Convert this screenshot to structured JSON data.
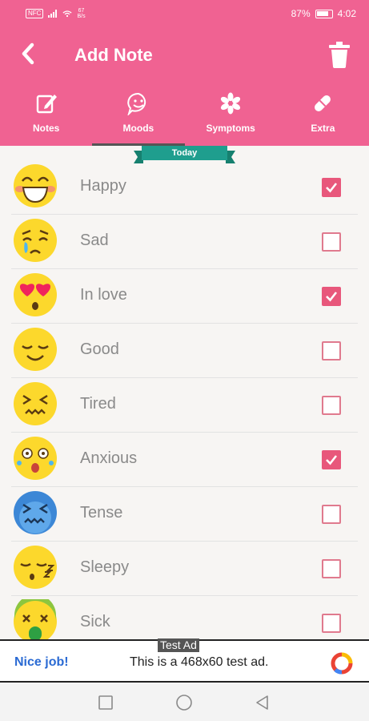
{
  "status_bar": {
    "carrier_badge": "NFC",
    "speed_value": "67",
    "speed_unit": "B/s",
    "battery_percent": "87%",
    "time": "4:02"
  },
  "app_bar": {
    "title": "Add Note",
    "back_icon": "chevron-left-icon",
    "delete_icon": "trash-icon"
  },
  "tabs": [
    {
      "label": "Notes",
      "icon": "note-edit-icon",
      "active": false
    },
    {
      "label": "Moods",
      "icon": "smiley-chat-icon",
      "active": true
    },
    {
      "label": "Symptoms",
      "icon": "asterisk-icon",
      "active": false
    },
    {
      "label": "Extra",
      "icon": "pill-icon",
      "active": false
    }
  ],
  "date_ribbon": {
    "label": "Today"
  },
  "moods": [
    {
      "label": "Happy",
      "checked": true,
      "icon": "happy-emoji-icon"
    },
    {
      "label": "Sad",
      "checked": false,
      "icon": "sad-emoji-icon"
    },
    {
      "label": "In love",
      "checked": true,
      "icon": "in-love-emoji-icon"
    },
    {
      "label": "Good",
      "checked": false,
      "icon": "good-emoji-icon"
    },
    {
      "label": "Tired",
      "checked": false,
      "icon": "tired-emoji-icon"
    },
    {
      "label": "Anxious",
      "checked": true,
      "icon": "anxious-emoji-icon"
    },
    {
      "label": "Tense",
      "checked": false,
      "icon": "tense-emoji-icon"
    },
    {
      "label": "Sleepy",
      "checked": false,
      "icon": "sleepy-emoji-icon"
    },
    {
      "label": "Sick",
      "checked": false,
      "icon": "sick-emoji-icon"
    }
  ],
  "ad": {
    "tag": "Test Ad",
    "nice": "Nice job!",
    "text": "This is a 468x60 test ad."
  },
  "colors": {
    "primary": "#f06292",
    "checkbox_checked": "#e8577b",
    "ribbon": "#1f9e8e"
  }
}
